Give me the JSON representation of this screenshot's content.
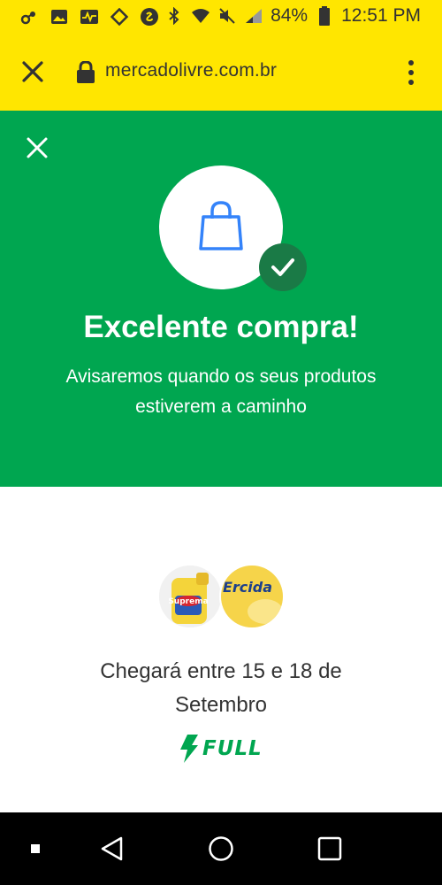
{
  "status_bar": {
    "battery": "84%",
    "time": "12:51 PM",
    "left_icons": [
      "link-icon",
      "image-icon",
      "activity-icon",
      "diamond-icon",
      "shazam-icon"
    ],
    "right_icons": [
      "bluetooth-icon",
      "wifi-icon",
      "mute-icon",
      "signal-icon",
      "battery-icon"
    ]
  },
  "browser": {
    "url": "mercadolivre.com.br",
    "close_icon": "close-icon",
    "lock_icon": "lock-icon",
    "menu_icon": "more-vert-icon"
  },
  "banner": {
    "title": "Excelente compra!",
    "subtitle": "Avisaremos quando os seus produtos estiverem a caminho",
    "bg_color": "#00a650",
    "icon": "shopping-bag-icon",
    "badge_icon": "check-icon"
  },
  "delivery": {
    "text": "Chegará entre 15 e 18 de Setembro",
    "products": [
      {
        "label": "Suprema"
      },
      {
        "label": "Ercida"
      }
    ],
    "badge": "FULL",
    "badge_color": "#00a650"
  },
  "nav": {
    "items": [
      "recents-icon",
      "back-icon",
      "home-icon",
      "overview-icon"
    ]
  }
}
